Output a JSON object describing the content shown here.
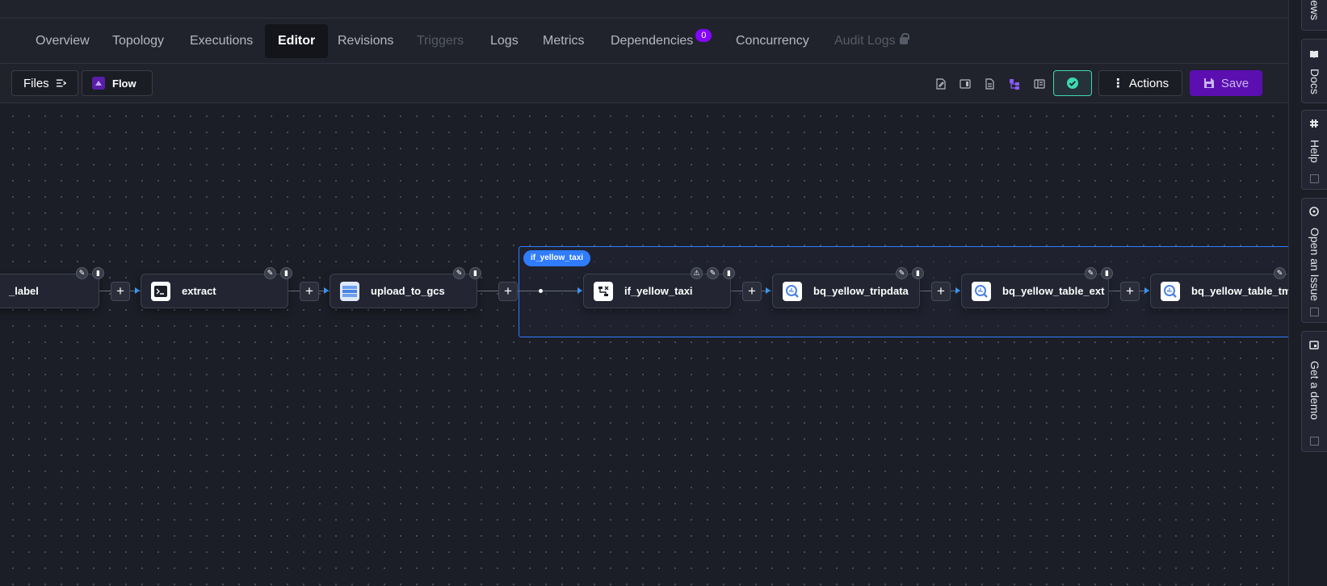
{
  "tabs": [
    {
      "label": "Overview",
      "state": "normal"
    },
    {
      "label": "Topology",
      "state": "normal"
    },
    {
      "label": "Executions",
      "state": "normal"
    },
    {
      "label": "Editor",
      "state": "active"
    },
    {
      "label": "Revisions",
      "state": "normal"
    },
    {
      "label": "Triggers",
      "state": "disabled"
    },
    {
      "label": "Logs",
      "state": "normal"
    },
    {
      "label": "Metrics",
      "state": "normal"
    },
    {
      "label": "Dependencies",
      "state": "normal",
      "badge": "0"
    },
    {
      "label": "Concurrency",
      "state": "normal"
    },
    {
      "label": "Audit Logs",
      "state": "disabled",
      "locked": true
    }
  ],
  "toolbar": {
    "files_label": "Files",
    "flow_label": "Flow",
    "actions_label": "Actions",
    "save_label": "Save"
  },
  "graph": {
    "cluster_label": "if_yellow_taxi",
    "nodes": [
      {
        "label": "_label",
        "icon": "partial-node-icon"
      },
      {
        "label": "extract",
        "icon": "terminal-icon"
      },
      {
        "label": "upload_to_gcs",
        "icon": "storage-icon"
      },
      {
        "label": "if_yellow_taxi",
        "icon": "condition-icon",
        "warning": true
      },
      {
        "label": "bq_yellow_tripdata",
        "icon": "bigquery-icon"
      },
      {
        "label": "bq_yellow_table_ext",
        "icon": "bigquery-icon"
      },
      {
        "label": "bq_yellow_table_tmp",
        "icon": "bigquery-icon"
      }
    ]
  },
  "rightbar": {
    "top_label": "iews",
    "docs_label": "Docs",
    "help_label": "Help",
    "issue_label": "Open an Issue",
    "demo_label": "Get a demo"
  },
  "colors": {
    "accent_purple": "#8405ff",
    "cluster_blue": "#2f7cff",
    "check_teal": "#3dd9b0",
    "arrow_blue": "#3b9cff"
  }
}
